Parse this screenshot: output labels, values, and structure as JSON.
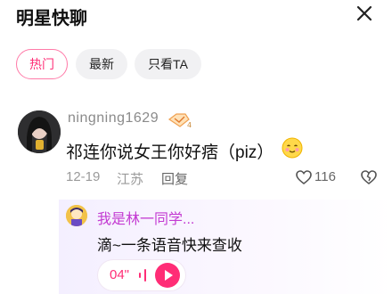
{
  "header": {
    "title": "明星快聊"
  },
  "tabs": [
    {
      "label": "热门"
    },
    {
      "label": "最新"
    },
    {
      "label": "只看TA"
    }
  ],
  "comment": {
    "username": "ningning1629",
    "text": "祁连你说女王你好痞（piz）",
    "date": "12-19",
    "location": "江苏",
    "reply_label": "回复",
    "like_count": "116"
  },
  "reply": {
    "username": "我是林一同学...",
    "text": "滴~一条语音快来查收",
    "voice_duration": "04\""
  },
  "colors": {
    "accent": "#ff2d76",
    "reply_name": "#c33ad2",
    "muted": "#9a9a9a"
  }
}
